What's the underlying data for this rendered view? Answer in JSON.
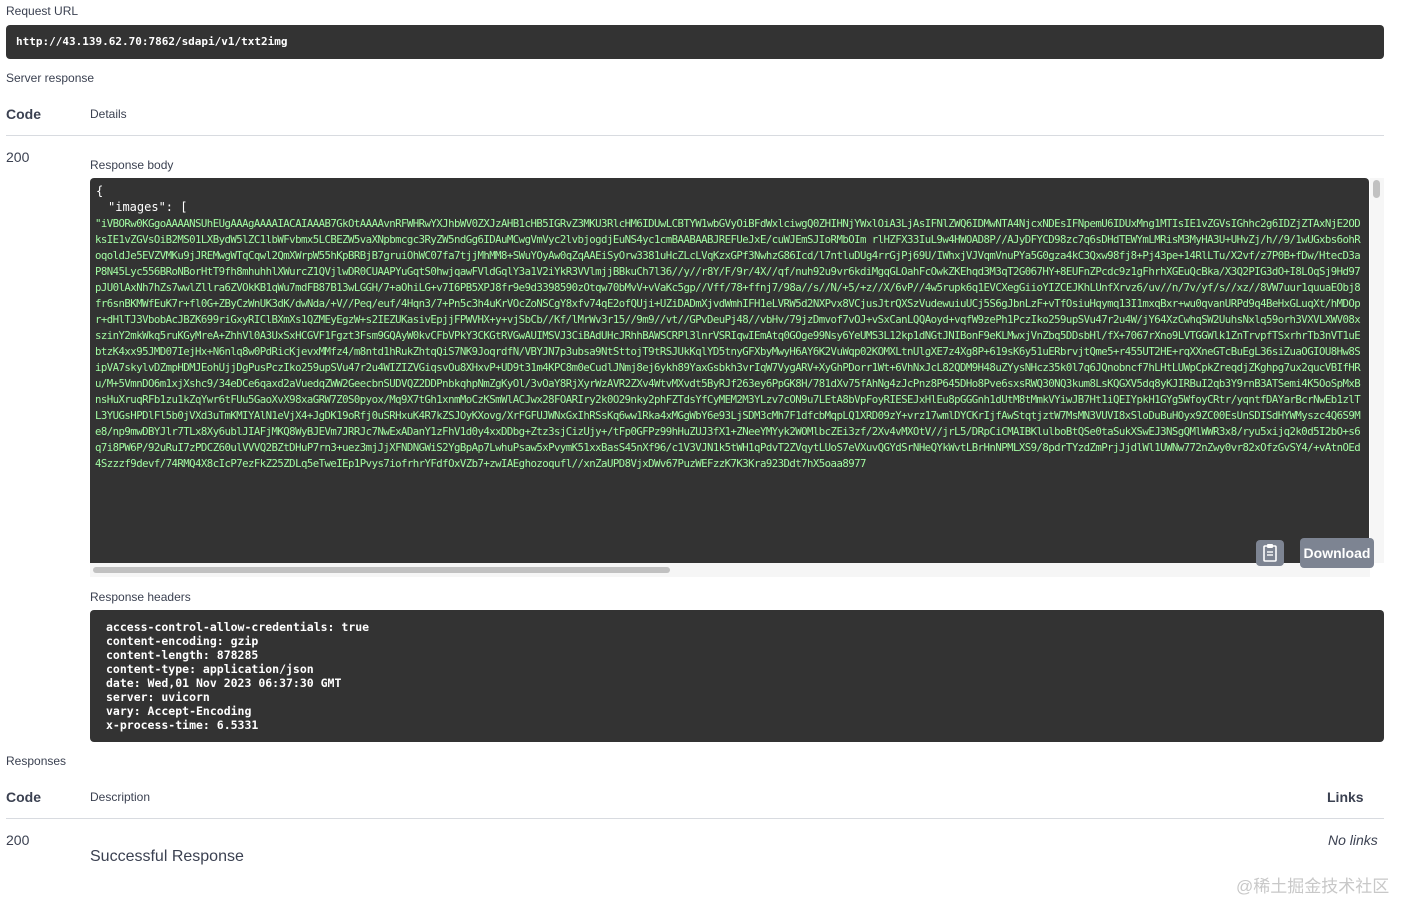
{
  "request": {
    "label": "Request URL",
    "url": "http://43.139.62.70:7862/sdapi/v1/txt2img"
  },
  "server_response": {
    "label": "Server response",
    "code_header": "Code",
    "details_header": "Details",
    "status_code": "200",
    "response_body_label": "Response body",
    "json_open": "{",
    "images_key": "\"images\": [",
    "base64_text": "\"iVBORw0KGgoAAAANSUhEUgAAAgAAAAIACAIAAAB7GkOtAAAAvnRFWHRwYXJhbWV0ZXJzAHB1cHB5IGRvZ3MKU3RlcHM6IDUwLCBTYW1wbGVyOiBFdWxlciwgQ0ZHIHNjYWxlOiA3LjAsIFNlZWQ6IDMwNTA4NjcxNDEsIFNpemU6IDUxMng1MTIsIE1vZGVsIGhhc2g6IDZjZTAxNjE2ODksIE1vZGVsOiB2MS01LXBydW5lZC1lbWFvbmx5LCBEZW5vaXNpbmcgc3RyZW5ndGg6IDAuMCwgVmVyc2lvbjogdjEuNS4yc1cmBAABAABJREFUeJxE/cuWJEmSJIoRMbOIm rlHZFX33IuL9w4HWOAD8P//AJyDFYCD98zc7q6sDHdTEWYmLMRisM3MyHA3U+UHvZj/h//9/1wUGxbs6ohRoqoldJe5EVZVMKu9jJREMwgWTqCqwl2QmXWrpW55hKpBRBjB7gruiOhWC07fa7tjjMhMM8+SWuYOyAw0qZqAAEiSyOrw3381uHcZLcLVqKzxGPf3NwhzG86Icd/l7ntluDUg4rrGjPj69U/IWhxjVJVqmVnuPYa5G0gza4kC3Qxw98fj8+Pj43pe+14RlLTu/X2vf/z7P0B+fDw/HtecD3aP8N45Lyc556BRoNBorHtT9fh8mhuhhlXWurcZ1QVjlwDR0CUAAPYuGqtS0hwjqawFVldGqlY3a1V2iYkR3VVlmjjBBkuCh7l36//y//r8Y/F/9r/4X//qf/nuh92u9vr6kdiMgqGLOahFcOwkZKEhqd3M3qT2G067HY+8EUFnZPcdc9z1gFhrhXGEuQcBka/X3Q2PIG3dO+I8LOqSj9Hd97pJU0lAxNh7hZs7wwlZllra6ZVOkKB1qWu7mdFB87B13wLGGH/7+aOhiLG+v7I6PB5XPJ8fr9e9d3398590zOtqw70bMvV+vVaKc5gp//Vff/78+ffnj7/98a//s//N/+5/+z//X/6vP//4w5rupk6q1EVCXegGiioYIZCEJKhLUnfXrvz6/uv//n/7v/yf/s//xz//8VW7uur1quuaEObj8fr6snBKMWfEuK7r+fl0G+ZByCzWnUK3dK/dwNda/+V//Peq/euf/4Hqn3/7+Pn5c3h4uKrVOcZoNSCgY8xfv74qE2ofQUji+UZiDADmXjvdWmhIFH1eLVRW5d2NXPvx8VCjusJtrQXSzVudewuiuUCj5S6gJbnLzF+vTfOsiuHqymq13I1mxqBxr+wu0qvanURPd9q4BeHxGLuqXt/hMDOpr+dHlTJ3VbobAcJBZK699riGxyRIClBXmXs1QZMEyEgzW+s2IEZUKasivEpjjFPWVHX+y+vjSbCb//Kf/lMrWv3r15//9m9//vt//GPvDeuPj48//vbHv/79jzDmvof7vOJ+vSxCanLQQAoyd+vqfW9zePh1PczIko259upSVu47r2u4W/jY64XzCwhqSW2UuhsNxlq59orh3VXVLXWV08xszinY2mkWkq5ruKGyMreA+ZhhVl0A3UxSxHCGVF1Fgzt3Fsm9GQAyW0kvCFbVPkY3CKGtRVGwAUIMSVJ3CiBAdUHcJRhhBAWSCRPl3lnrVSRIqwIEmAtq0GOge99Nsy6YeUMS3L12kp1dNGtJNIBonF9eKLMwxjVnZbq5DDsbHl/fX+7067rXno9LVTGGWlk1ZnTrvpfTSxrhrTb3nVT1uEbtzK4xx95JMD07IejHx+N6nlq8w0PdRicKjevxMMfz4/m8ntd1hRukZhtqQiS7NK9JoqrdfN/VBYJN7p3ubsa9NtSttojT9tRSJUkKqlYD5tnyGFXbyMwyH6AY6K2VuWqp02KOMXLtnUlgXE7z4Xg8P+619sK6y51uERbrvjtQme5+r455UT2HE+rqXXneGTcBuEgL36siZuaOGIOU8Hw8SipVA7skylvDZmpHDMJEohUjjDgPusPczIko259upSVu47r2u4WIZIZVGiqsvOu8XHxvP+UD9t31m4KPC8m0eCudlJNmj8ej6ykh89YaxGsbkh3vrIqW7VygARV+XyGhPDorr1Wt+6VhNxJcL82QDM9H48uZYysNHcz35k0l7q6JQnobncf7hLHtLUWpCpkZreqdjZKghpg7ux2qucVBIfHRu/M+5VmnDO6m1xjXshc9/34eDCe6qaxd2aVuedqZWW2GeecbnSUDVQZ2DDPnbkqhpNmZgKyOl/3vOaY8RjXyrWzAVR2ZXv4WtvMXvdt5ByRJf263ey6PpGK8H/781dXv75fAhNg4zJcPnz8P645DHo8Pve6sxsRWQ30NQ3kum8LsKQGXV5dq8yKJIRBuI2qb3Y9rnB3ATSemi4K5OoSpMxBnsHuXruqRFb1zu1kZqYwr6tFUu5GaoXvX98xaGRW7Z0S0pyox/Mq9X7tGh1xnmMoCzKSmWlACJwx28FOARIry2k0O29nky2phFZTdsYfCyMEM2M3YLzv7cON9u7LEtA8bVpFoyRIESEJxHlEu8pGGGnh1dUtM8tMmkVYiwJB7Ht1iQEIYpkH1GYg5WfoyCRtr/yqntfDAYarBcrNwEb1zlTL3YUGsHPDlFl5b0jVXd3uTmKMIYAlN1eVjX4+JgDK19oRfj0uSRHxuK4R7kZSJOyKXovg/XrFGFUJWNxGxIhRSsKq6ww1Rka4xMGgWbY6e93LjSDM3cMh7F1dfcbMqpLQ1XRD09zY+vrz17wmlDYCKrIjfAwStqtjztW7MsMN3VUVI8xSloDuBuHOyx9ZC00EsUnSDISdHYWMyszc4Q6S9Me8/np9mwDBYJlr7TLx8Xy6ublJIAFjMKQ8WyBJEVm7JRRJc7NwExADanY1zFhV1d0y4xxDDbg+Ztz3sjCizUjy+/tFp0GFPz99hHuZUJ3fX1+ZNeeYMYyk2WOMlbcZEi3zf/2Xv4vMXOtV//jrL5/DRpCiCMAIBKlulboBtQSe0taSukXSwEJ3NSgQMlWWR3x8/ryu5xijq2k0d5I2bO+s6q7i8PW6P/92uRuI7zPDCZ60ulVVVQ2BZtDHuP7rn3+uez3mjJjXFNDNGWiS2YgBpAp7LwhuPsaw5xPvymK51xxBasS45nXf96/c1V3VJN1k5tWH1qPdvT2ZVqytLUoS7eVXuvQGYdSrNHeQYkWvtLBrHnNPMLXS9/8pdrTYzdZmPrjJjdlWl1UWNw772nZwy0vr82xOfzGvSY4/+vAtnOEd4Szzzf9devf/74RMQ4X8cIcP7ezFkZ25ZDLq5eTweIEp1Pvys7iofrhrYFdfOxVZb7+zwIAEghozoqufl//xnZaUPD8VjxDWv67PuzWEFzzK7K3Kra923Ddt7hX5oaa8977"
  },
  "response_headers": {
    "label": "Response headers",
    "lines": [
      "access-control-allow-credentials: true",
      "content-encoding: gzip",
      "content-length: 878285",
      "content-type: application/json",
      "date: Wed,01 Nov 2023 06:37:30 GMT",
      "server: uvicorn",
      "vary: Accept-Encoding",
      "x-process-time: 6.5331"
    ]
  },
  "buttons": {
    "download": "Download",
    "copy_icon": "clipboard-icon"
  },
  "responses": {
    "label": "Responses",
    "code_header": "Code",
    "description_header": "Description",
    "links_header": "Links",
    "row": {
      "code": "200",
      "description": "Successful Response",
      "links": "No links"
    }
  },
  "watermark": "@稀土掘金技术社区"
}
